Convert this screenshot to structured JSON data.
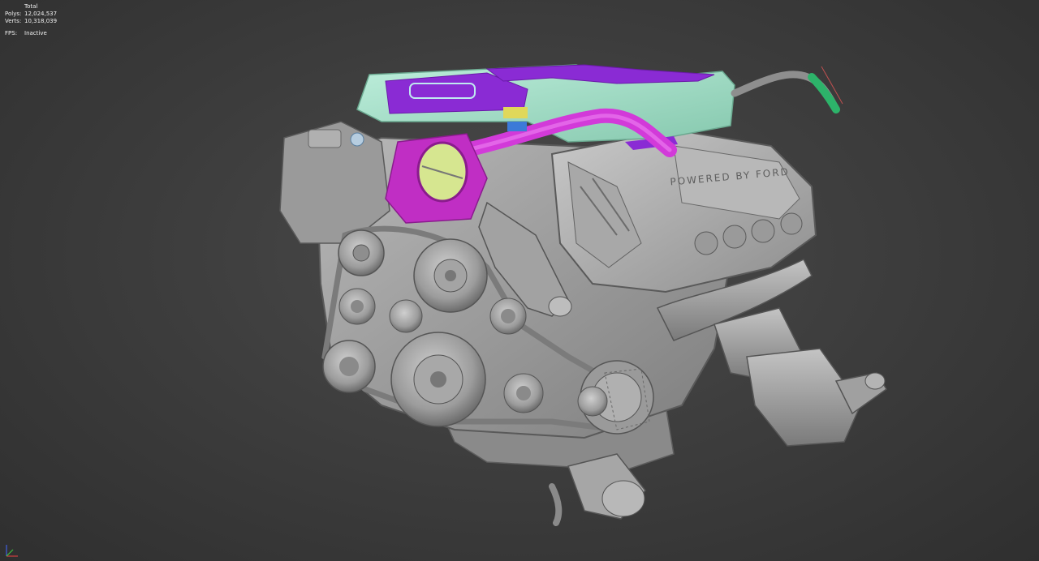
{
  "stats": {
    "header": "Total",
    "polys_label": "Polys:",
    "polys_value": "12,024,537",
    "verts_label": "Verts:",
    "verts_value": "10,318,039",
    "fps_label": "FPS:",
    "fps_value": "Inactive"
  },
  "model": {
    "cover_text": "POWERED BY FORD",
    "colors": {
      "body": "#a9a9a9",
      "body_dark": "#7d7d7d",
      "body_light": "#c4c4c4",
      "intake_mint": "#9fdcc4",
      "intake_purple": "#8a2bd4",
      "hose_magenta": "#d23ad9",
      "throttle_magenta": "#c02ec4",
      "accent_yellow": "#e0d85a",
      "accent_blue": "#3c7ad8",
      "accent_green": "#2db36a",
      "accent_teal": "#1fb8b0"
    }
  },
  "gizmo": {
    "x_color": "#d04040",
    "y_color": "#40c040",
    "z_color": "#4060e0"
  }
}
